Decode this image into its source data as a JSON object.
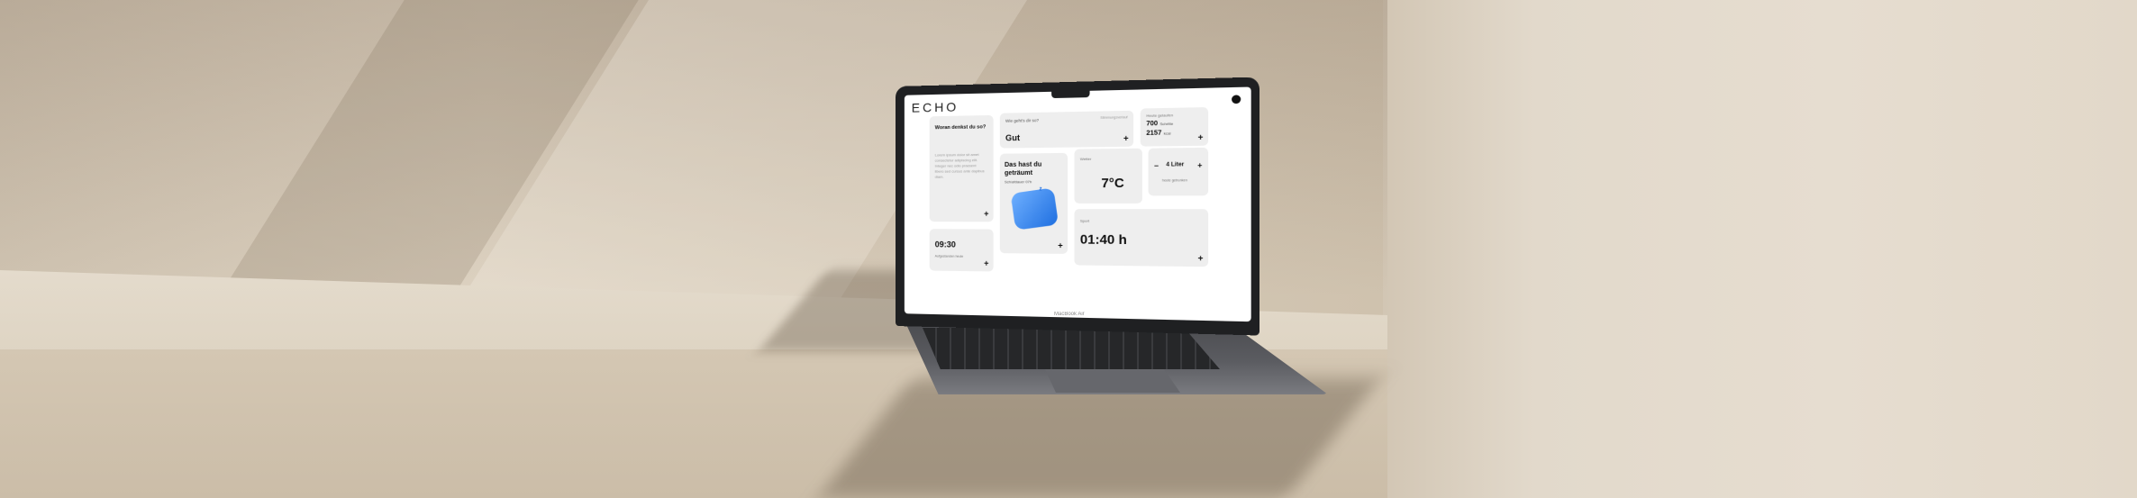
{
  "device": {
    "brand_label": "MacBook Air"
  },
  "app": {
    "logo": "ECHO",
    "cards": {
      "mind": {
        "title": "Woran denkst du so?",
        "body": "Lorem ipsum dolor sit amet consectetur adipiscing elit. Integer nec odio praesent libero sed cursus ante dapibus diam."
      },
      "feeling": {
        "question": "Wie geht's dir so?",
        "value": "Gut",
        "chips": "Stimmungsverlauf"
      },
      "steps": {
        "label": "Heute gelaufen",
        "value1": "700",
        "unit1": "Schritte",
        "value2": "2157",
        "unit2": "kcal"
      },
      "dream": {
        "title": "Das hast du geträumt",
        "subtitle": "Schlafdauer 07h"
      },
      "temperature": {
        "label": "Wetter",
        "value": "7°C"
      },
      "water": {
        "minus": "–",
        "value": "4 Liter",
        "plus": "+",
        "subtitle": "heute getrunken"
      },
      "time": {
        "value": "09:30",
        "subtitle": "Aufgestanden heute"
      },
      "sport": {
        "label": "Sport",
        "value": "01:40 h"
      }
    },
    "plus_symbol": "+"
  }
}
